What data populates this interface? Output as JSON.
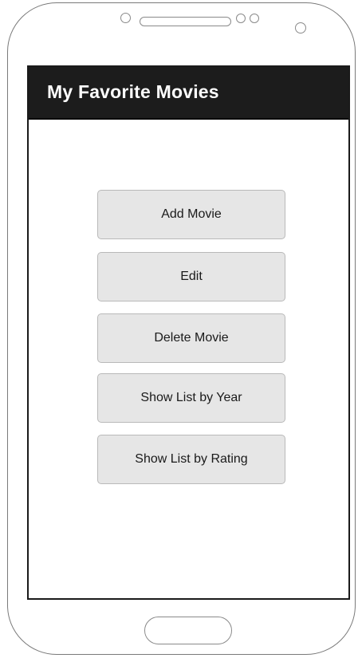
{
  "app": {
    "title": "My Favorite Movies"
  },
  "menu": {
    "buttons": [
      {
        "label": "Add Movie"
      },
      {
        "label": "Edit"
      },
      {
        "label": "Delete Movie"
      },
      {
        "label": "Show List by Year"
      },
      {
        "label": "Show List by Rating"
      }
    ]
  },
  "device": {
    "icons": [
      "front-camera-icon",
      "speaker-grille",
      "proximity-sensor-icon",
      "light-sensor-icon",
      "secondary-camera-icon",
      "home-button"
    ]
  }
}
